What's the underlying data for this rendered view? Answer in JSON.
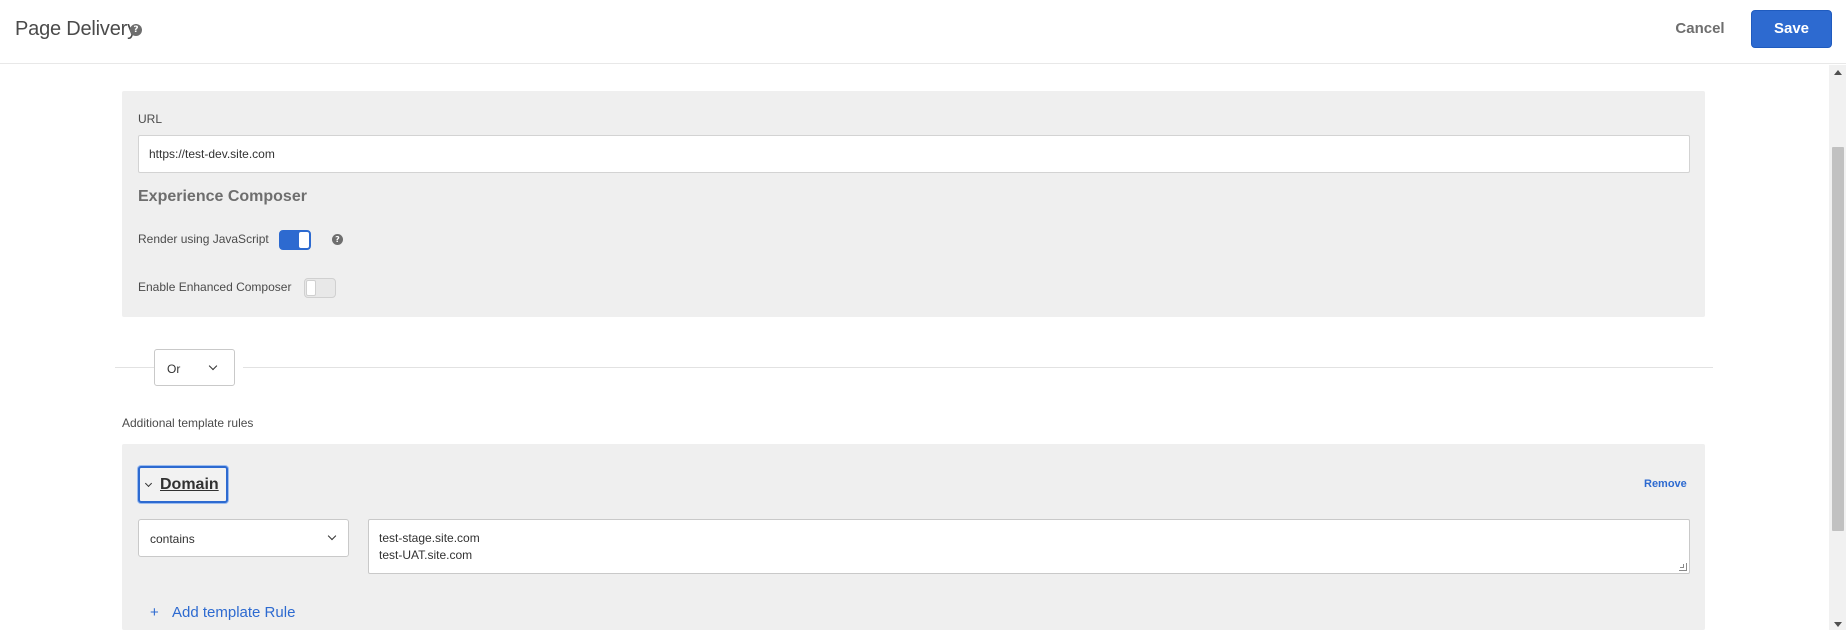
{
  "header": {
    "title": "Page Delivery",
    "help_icon": "question-circle-icon",
    "cancel_label": "Cancel",
    "save_label": "Save"
  },
  "url_section": {
    "label": "URL",
    "value": "https://test-dev.site.com"
  },
  "experience_composer": {
    "heading": "Experience Composer",
    "render_js": {
      "label": "Render using JavaScript",
      "enabled": true,
      "help_icon": "question-circle-icon"
    },
    "enhanced": {
      "label": "Enable Enhanced Composer",
      "enabled": false
    }
  },
  "logic_select": {
    "selected": "Or"
  },
  "template_rules": {
    "section_label": "Additional template rules",
    "rule": {
      "type_label": "Domain",
      "remove_label": "Remove",
      "operator": "contains",
      "values": [
        "test-stage.site.com",
        "test-UAT.site.com"
      ]
    },
    "add_rule_label": "Add template Rule",
    "add_rule_icon": "plus-icon"
  },
  "colors": {
    "accent": "#2d6ad0",
    "panel_bg": "#efefef"
  }
}
